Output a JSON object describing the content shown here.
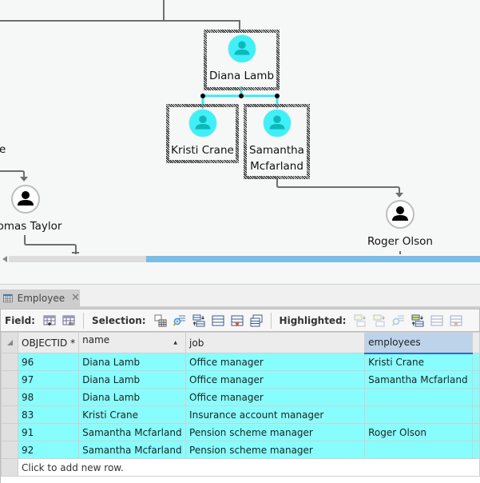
{
  "diagram": {
    "nodes": [
      {
        "id": "diana",
        "label": "Diana Lamb",
        "style": "cyan",
        "selected": true
      },
      {
        "id": "kristi",
        "label": "Kristi Crane",
        "style": "cyan",
        "selected": true
      },
      {
        "id": "samantha",
        "label_lines": [
          "Samantha",
          "Mcfarland"
        ],
        "style": "cyan",
        "selected": true
      },
      {
        "id": "thomas",
        "label": "omas Taylor",
        "style": "plain",
        "selected": false
      },
      {
        "id": "offscreen",
        "label": "e",
        "style": "none",
        "selected": false
      },
      {
        "id": "roger",
        "label": "Roger Olson",
        "style": "plain",
        "selected": false
      }
    ],
    "colors": {
      "selected_link": "#3ee8f0",
      "link": "#6e6e6e",
      "node_fill": "#3ff0f7"
    }
  },
  "tab": {
    "label": "Employee",
    "icon": "table-icon",
    "close": "✕"
  },
  "toolbar": {
    "field_label": "Field:",
    "selection_label": "Selection:",
    "highlighted_label": "Highlighted:"
  },
  "table": {
    "columns": [
      "OBJECTID *",
      "name",
      "job",
      "employees"
    ],
    "sort_indicator": "▲",
    "rows": [
      {
        "objectid": "96",
        "name": "Diana Lamb",
        "job": "Office manager",
        "employees": "Kristi Crane"
      },
      {
        "objectid": "97",
        "name": "Diana Lamb",
        "job": "Office manager",
        "employees": "Samantha Mcfarland"
      },
      {
        "objectid": "98",
        "name": "Diana Lamb",
        "job": "Office manager",
        "employees": ""
      },
      {
        "objectid": "83",
        "name": "Kristi Crane",
        "job": "Insurance account manager",
        "employees": ""
      },
      {
        "objectid": "91",
        "name": "Samantha Mcfarland",
        "job": "Pension scheme manager",
        "employees": "Roger Olson"
      },
      {
        "objectid": "92",
        "name": "Samantha Mcfarland",
        "job": "Pension scheme manager",
        "employees": ""
      }
    ],
    "add_row_text": "Click to add new row.",
    "selection_color": "#88fdfd"
  }
}
